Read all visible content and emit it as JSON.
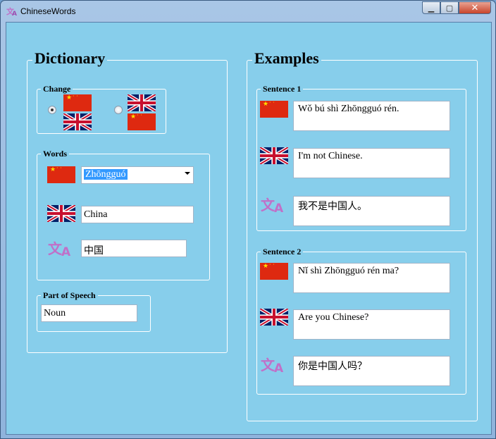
{
  "window": {
    "title": "ChineseWords",
    "icons": [
      "translate-icon"
    ],
    "controls": [
      "minimize",
      "maximize",
      "close"
    ]
  },
  "dictionary": {
    "header": "Dictionary",
    "change": {
      "label": "Change",
      "options": [
        {
          "from": "chinese-flag",
          "to": "uk-flag",
          "selected": true
        },
        {
          "from": "uk-flag",
          "to": "chinese-flag",
          "selected": false
        }
      ]
    },
    "words": {
      "label": "Words",
      "chinese_value": "Zhōngguó",
      "english_value": "China",
      "hanzi_value": "中国"
    },
    "part_of_speech": {
      "label": "Part of Speech",
      "value": "Noun"
    }
  },
  "examples": {
    "header": "Examples",
    "sentences": [
      {
        "label": "Sentence 1",
        "pinyin": "Wǒ bú shì Zhōngguó rén.",
        "english": "I'm not Chinese.",
        "hanzi": "我不是中国人。"
      },
      {
        "label": "Sentence 2",
        "pinyin": "Nǐ shì Zhōngguó rén ma?",
        "english": "Are you Chinese?",
        "hanzi": "你是中国人吗？"
      }
    ]
  },
  "colors": {
    "background": "#87ceeb",
    "chinese_flag": "#de2910",
    "translate_icon": "#c070c8"
  }
}
